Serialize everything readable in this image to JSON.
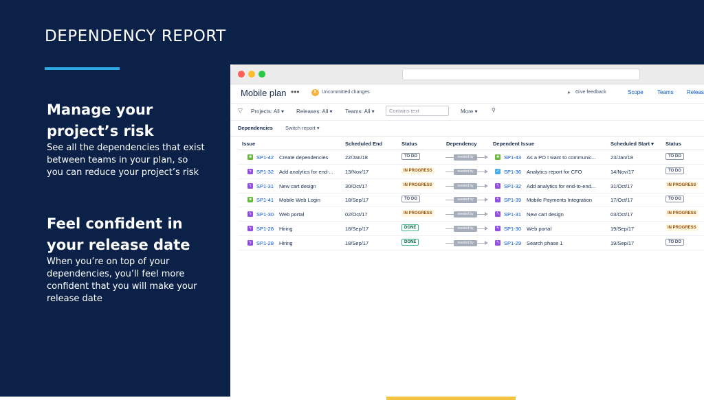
{
  "slide": {
    "title": "DEPENDENCY REPORT",
    "section1": {
      "heading": "Manage your project’s risk",
      "body": "See all the dependencies that exist between teams in your plan, so you can reduce your project’s risk"
    },
    "section2": {
      "heading": "Feel confident in your release date",
      "body": "When you’re on top of your dependencies, you’ll feel more confident that you will make your release date"
    }
  },
  "colors": {
    "slide_bg": "#0b2148",
    "accent": "#2ea8e0",
    "bottom_bar": "#f5c342",
    "link": "#0052cc"
  },
  "app": {
    "plan_title": "Mobile plan",
    "more_label": "•••",
    "uncommitted_count": "8",
    "uncommitted_label": "Uncommitted changes",
    "feedback_label": "Give feedback",
    "nav": [
      "Scope",
      "Teams",
      "Releases"
    ],
    "filters": {
      "projects": "Projects: All ▾",
      "releases": "Releases: All ▾",
      "teams": "Teams: All ▾",
      "search_placeholder": "Contains text",
      "more": "More ▾"
    },
    "tabs": {
      "active": "Dependencies",
      "switch": "Switch report ▾"
    },
    "columns": {
      "issue": "Issue",
      "scheduled_end": "Scheduled End",
      "status": "Status",
      "dependency": "Dependency",
      "dependent_issue": "Dependent Issue",
      "scheduled_start": "Scheduled Start ▾",
      "status2": "Status"
    },
    "dependency_label": "needed by",
    "rows": [
      {
        "issue_icon": "story",
        "issue_key": "SP1-42",
        "issue_summary": "Create dependencies",
        "scheduled_end": "22/Jan/18",
        "status": "TO DO",
        "dep_icon": "story",
        "dep_key": "SP1-43",
        "dep_summary": "As a PO I want to communic...",
        "scheduled_start": "23/Jan/18",
        "dep_status": "TO DO"
      },
      {
        "issue_icon": "epic",
        "issue_key": "SP1-32",
        "issue_summary": "Add analytics for end-...",
        "scheduled_end": "13/Nov/17",
        "status": "IN PROGRESS",
        "dep_icon": "task",
        "dep_key": "SP1-36",
        "dep_summary": "Analytics report for CFO",
        "scheduled_start": "14/Nov/17",
        "dep_status": "TO DO"
      },
      {
        "issue_icon": "epic",
        "issue_key": "SP1-31",
        "issue_summary": "New cart design",
        "scheduled_end": "30/Oct/17",
        "status": "IN PROGRESS",
        "dep_icon": "epic",
        "dep_key": "SP1-32",
        "dep_summary": "Add analytics for end-to-end...",
        "scheduled_start": "31/Oct/17",
        "dep_status": "IN PROGRESS"
      },
      {
        "issue_icon": "story",
        "issue_key": "SP1-41",
        "issue_summary": "Mobile Web Login",
        "scheduled_end": "18/Sep/17",
        "status": "TO DO",
        "dep_icon": "epic",
        "dep_key": "SP1-39",
        "dep_summary": "Mobile Payments Integration",
        "scheduled_start": "17/Oct/17",
        "dep_status": "TO DO"
      },
      {
        "issue_icon": "epic",
        "issue_key": "SP1-30",
        "issue_summary": "Web portal",
        "scheduled_end": "02/Oct/17",
        "status": "IN PROGRESS",
        "dep_icon": "epic",
        "dep_key": "SP1-31",
        "dep_summary": "New cart design",
        "scheduled_start": "03/Oct/17",
        "dep_status": "IN PROGRESS"
      },
      {
        "issue_icon": "epic",
        "issue_key": "SP1-28",
        "issue_summary": "Hiring",
        "scheduled_end": "18/Sep/17",
        "status": "DONE",
        "dep_icon": "epic",
        "dep_key": "SP1-30",
        "dep_summary": "Web portal",
        "scheduled_start": "19/Sep/17",
        "dep_status": "IN PROGRESS"
      },
      {
        "issue_icon": "epic",
        "issue_key": "SP1-28",
        "issue_summary": "Hiring",
        "scheduled_end": "18/Sep/17",
        "status": "DONE",
        "dep_icon": "epic",
        "dep_key": "SP1-29",
        "dep_summary": "Search phase 1",
        "scheduled_start": "19/Sep/17",
        "dep_status": "TO DO"
      }
    ]
  }
}
